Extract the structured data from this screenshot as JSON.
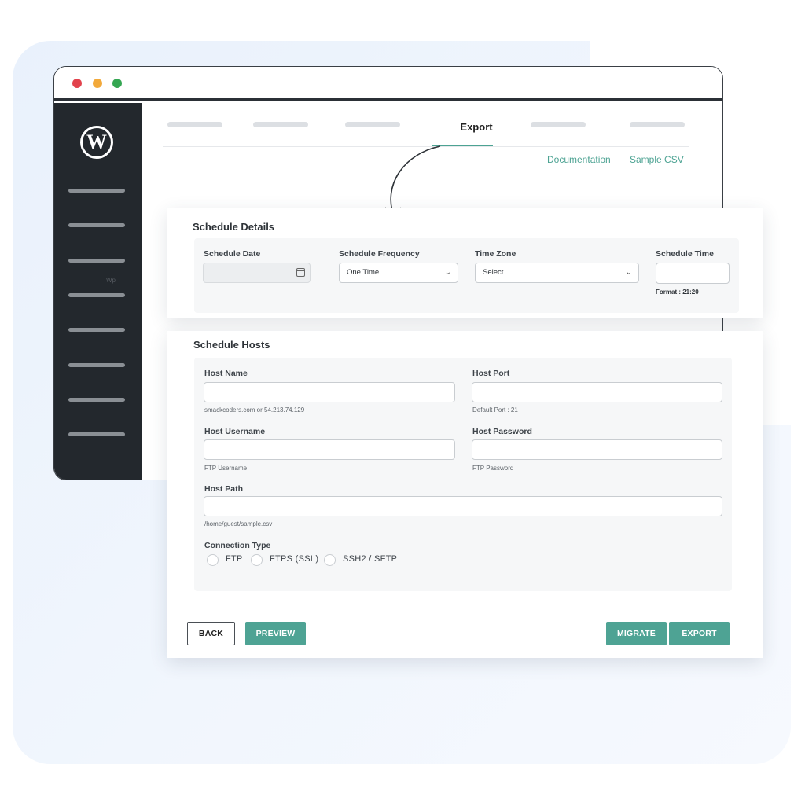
{
  "window": {
    "tabs": {
      "active_label": "Export"
    },
    "links": {
      "documentation": "Documentation",
      "sample_csv": "Sample CSV"
    },
    "sidebar": {
      "logo_glyph": "W",
      "tiny_label": "Wp",
      "check_glyph": "✓"
    }
  },
  "schedule_details": {
    "title": "Schedule Details",
    "schedule_date": {
      "label": "Schedule Date",
      "value": ""
    },
    "schedule_frequency": {
      "label": "Schedule Frequency",
      "value": "One Time"
    },
    "time_zone": {
      "label": "Time Zone",
      "value": "Select..."
    },
    "schedule_time": {
      "label": "Schedule Time",
      "value": "",
      "hint": "Format : 21:20"
    }
  },
  "schedule_hosts": {
    "title": "Schedule Hosts",
    "host_name": {
      "label": "Host Name",
      "value": "",
      "hint": "smackcoders.com or 54.213.74.129"
    },
    "host_port": {
      "label": "Host Port",
      "value": "",
      "hint": "Default Port : 21"
    },
    "host_username": {
      "label": "Host Username",
      "value": "",
      "hint": "FTP Username"
    },
    "host_password": {
      "label": "Host Password",
      "value": "",
      "hint": "FTP Password"
    },
    "host_path": {
      "label": "Host Path",
      "value": "",
      "hint": "/home/guest/sample.csv"
    },
    "connection_type": {
      "label": "Connection Type",
      "options": [
        "FTP",
        "FTPS (SSL)",
        "SSH2 / SFTP"
      ],
      "selected": null
    }
  },
  "actions": {
    "back": "BACK",
    "preview": "PREVIEW",
    "migrate": "MIGRATE",
    "export": "EXPORT"
  },
  "colors": {
    "accent": "#4ea394",
    "sidebar": "#23282d",
    "dot_red": "#e2434d",
    "dot_yellow": "#f2a93b",
    "dot_green": "#35a652"
  }
}
